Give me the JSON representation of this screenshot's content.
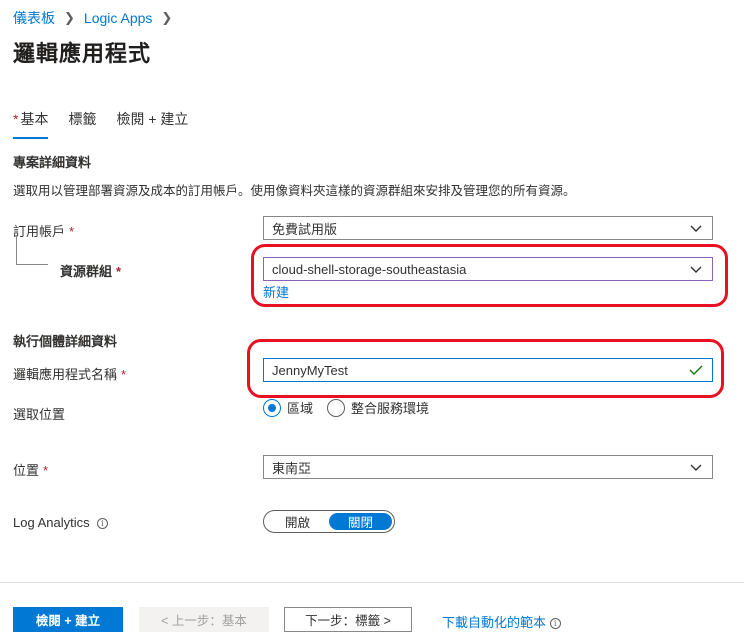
{
  "breadcrumb": {
    "items": [
      "儀表板",
      "Logic Apps"
    ]
  },
  "page_title": "邏輯應用程式",
  "tabs": [
    {
      "label": "基本",
      "required": true,
      "active": true
    },
    {
      "label": "標籤"
    },
    {
      "label": "檢閱 + 建立"
    }
  ],
  "project": {
    "heading": "專案詳細資料",
    "description": "選取用以管理部署資源及成本的訂用帳戶。使用像資料夾這樣的資源群組來安排及管理您的所有資源。",
    "subscription_label": "訂用帳戶",
    "subscription_value": "免費試用版",
    "resource_group_label": "資源群組",
    "resource_group_value": "cloud-shell-storage-southeastasia",
    "create_new_link": "新建"
  },
  "instance": {
    "heading": "執行個體詳細資料",
    "name_label": "邏輯應用程式名稱",
    "name_value": "JennyMyTest",
    "location_type_label": "選取位置",
    "radio_region": "區域",
    "radio_ise": "整合服務環境",
    "location_label": "位置",
    "location_value": "東南亞",
    "log_analytics_label": "Log Analytics",
    "toggle_on": "開啟",
    "toggle_off": "關閉"
  },
  "required_mark": "*",
  "footer": {
    "review_create": "檢閱 + 建立",
    "previous": "< 上一步：基本",
    "next": "下一步：標籤 >",
    "download_template": "下載自動化的範本"
  },
  "colors": {
    "accent": "#0078d4",
    "highlight": "#e81123",
    "required": "#a4262c"
  },
  "icons": {
    "chevron": "chevron-down-icon",
    "check": "checkmark-icon",
    "info": "info-icon"
  }
}
